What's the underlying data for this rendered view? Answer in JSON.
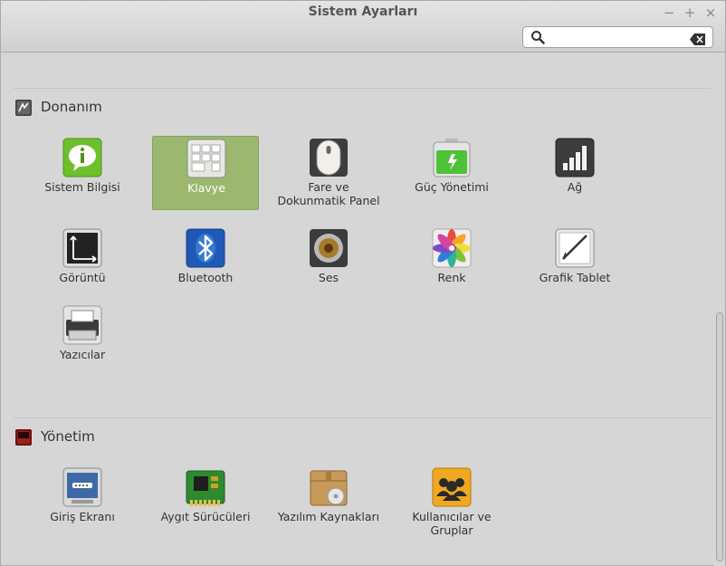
{
  "window": {
    "title": "Sistem Ayarları",
    "controls": {
      "minimize": "−",
      "maximize": "+",
      "close": "×"
    }
  },
  "search": {
    "value": "",
    "placeholder": ""
  },
  "sections": [
    {
      "title": "Donanım",
      "items": [
        {
          "label": "Sistem Bilgisi",
          "icon": "info-icon",
          "selected": false
        },
        {
          "label": "Klavye",
          "icon": "keyboard-icon",
          "selected": true
        },
        {
          "label": "Fare ve Dokunmatik Panel",
          "icon": "mouse-icon",
          "selected": false
        },
        {
          "label": "Güç Yönetimi",
          "icon": "battery-icon",
          "selected": false
        },
        {
          "label": "Ağ",
          "icon": "network-icon",
          "selected": false
        },
        {
          "label": "Görüntü",
          "icon": "display-icon",
          "selected": false
        },
        {
          "label": "Bluetooth",
          "icon": "bluetooth-icon",
          "selected": false
        },
        {
          "label": "Ses",
          "icon": "speaker-icon",
          "selected": false
        },
        {
          "label": "Renk",
          "icon": "color-icon",
          "selected": false
        },
        {
          "label": "Grafik Tablet",
          "icon": "tablet-icon",
          "selected": false
        },
        {
          "label": "Yazıcılar",
          "icon": "printer-icon",
          "selected": false
        }
      ]
    },
    {
      "title": "Yönetim",
      "items": [
        {
          "label": "Giriş Ekranı",
          "icon": "login-screen-icon",
          "selected": false
        },
        {
          "label": "Aygıt Sürücüleri",
          "icon": "driver-chip-icon",
          "selected": false
        },
        {
          "label": "Yazılım Kaynakları",
          "icon": "software-sources-icon",
          "selected": false
        },
        {
          "label": "Kullanıcılar ve Gruplar",
          "icon": "users-icon",
          "selected": false
        }
      ]
    }
  ],
  "colors": {
    "selection": "#9bb86e",
    "background": "#d6d6d6"
  }
}
